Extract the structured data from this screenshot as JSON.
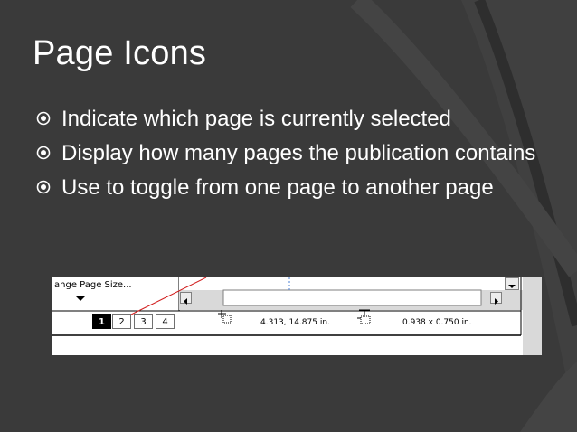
{
  "slide": {
    "title": "Page Icons",
    "bullets": [
      "Indicate which page is currently selected",
      "Display how many pages the publication contains",
      "Use to toggle from one page to another page"
    ]
  },
  "screenshot": {
    "page_size_label": "ange Page Size...",
    "pages": [
      "1",
      "2",
      "3",
      "4"
    ],
    "selected_page": "1",
    "position_readout": "4.313, 14.875 in.",
    "size_readout": "0.938 x  0.750 in.",
    "icons": [
      "position-crosshair-icon",
      "object-size-icon",
      "scroll-left-icon",
      "scroll-right-icon",
      "scroll-down-icon",
      "dropdown-arrow-icon"
    ]
  },
  "colors": {
    "background": "#3a3a3a",
    "deco_stripe": "#474747",
    "text": "#ffffff",
    "selected_page": "#000000",
    "guide_line": "#d21f1f"
  }
}
